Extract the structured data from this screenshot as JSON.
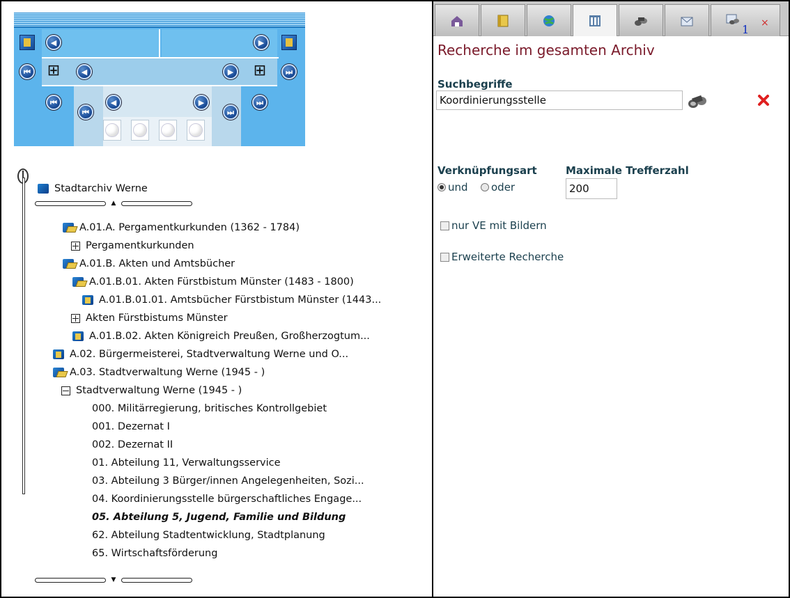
{
  "navigator": {
    "placeholders": 4
  },
  "tree": {
    "root": {
      "label": "Stadtarchiv Werne",
      "icon": "folder-icon"
    },
    "items": [
      {
        "label": "A.01.A. Pergamentkurkunden (1362 - 1784)",
        "icon": "folder-open-icon",
        "indent": 88
      },
      {
        "label": "Pergamentkurkunden",
        "icon": "expand-plus-icon",
        "indent": 100
      },
      {
        "label": "A.01.B. Akten und Amtsbücher",
        "icon": "folder-open-icon",
        "indent": 88
      },
      {
        "label": "A.01.B.01. Akten Fürstbistum Münster (1483 - 1800)",
        "icon": "folder-open-icon",
        "indent": 102
      },
      {
        "label": "A.01.B.01.01. Amtsbücher Fürstbistum Münster (1443...",
        "icon": "folder-icon",
        "indent": 116
      },
      {
        "label": "Akten Fürstbistums Münster",
        "icon": "expand-plus-icon",
        "indent": 100
      },
      {
        "label": "A.01.B.02. Akten Königreich Preußen, Großherzogtum...",
        "icon": "folder-icon",
        "indent": 102
      },
      {
        "label": "A.02. Bürgermeisterei, Stadtverwaltung Werne und O...",
        "icon": "folder-icon",
        "indent": 74
      },
      {
        "label": "A.03. Stadtverwaltung Werne (1945 - )",
        "icon": "folder-open-icon",
        "indent": 74
      },
      {
        "label": "Stadtverwaltung Werne (1945 - )",
        "icon": "collapse-minus-icon",
        "indent": 86
      },
      {
        "label": "000. Militärregierung, britisches Kontrollgebiet",
        "icon": "",
        "indent": 130
      },
      {
        "label": "001. Dezernat I",
        "icon": "",
        "indent": 130
      },
      {
        "label": "002. Dezernat II",
        "icon": "",
        "indent": 130
      },
      {
        "label": "01. Abteilung 11, Verwaltungsservice",
        "icon": "",
        "indent": 130
      },
      {
        "label": "03. Abteilung 3 Bürger/innen Angelegenheiten, Sozi...",
        "icon": "",
        "indent": 130
      },
      {
        "label": "04. Koordinierungsstelle bürgerschaftliches Engage...",
        "icon": "",
        "indent": 130
      },
      {
        "label": "05. Abteilung 5, Jugend, Familie und Bildung",
        "icon": "",
        "indent": 130,
        "selected": true
      },
      {
        "label": "62. Abteilung Stadtentwicklung, Stadtplanung",
        "icon": "",
        "indent": 130
      },
      {
        "label": "65. Wirtschaftsförderung",
        "icon": "",
        "indent": 130
      }
    ]
  },
  "tabs": [
    {
      "icon": "home-icon"
    },
    {
      "icon": "book-icon"
    },
    {
      "icon": "globe-icon"
    },
    {
      "icon": "archive-icon",
      "active": true
    },
    {
      "icon": "binoculars-icon"
    },
    {
      "icon": "mail-icon"
    },
    {
      "icon": "search-results-icon",
      "count": "1",
      "close": "×"
    }
  ],
  "search": {
    "title": "Recherche im gesamten Archiv",
    "terms_label": "Suchbegriffe",
    "terms_value": "Koordinierungsstelle",
    "link_label": "Verknüpfungsart",
    "option_and": "und",
    "option_or": "oder",
    "max_label": "Maximale Trefferzahl",
    "max_value": "200",
    "images_only": "nur VE mit Bildern",
    "advanced": "Erweiterte Recherche"
  },
  "colors": {
    "nav_bg": "#5cb4ec",
    "heading": "#7a1a2a",
    "label": "#1a3f4d"
  }
}
